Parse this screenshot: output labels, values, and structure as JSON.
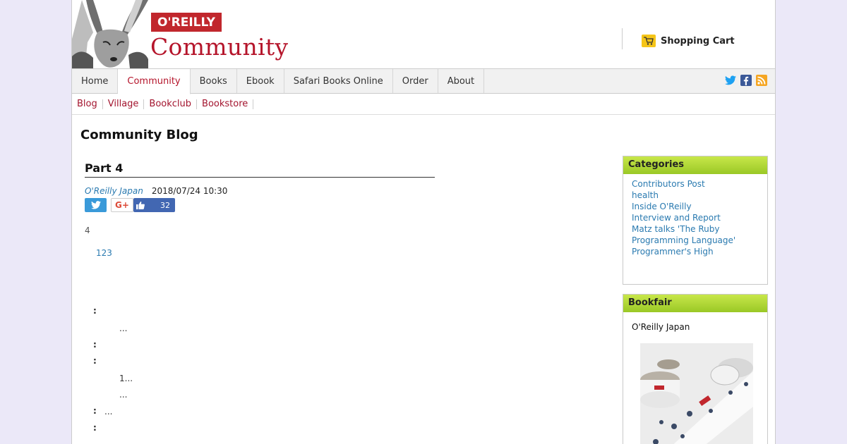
{
  "header": {
    "brand_badge": "O'REILLY",
    "brand_name": "Community",
    "cart_label": "Shopping Cart"
  },
  "nav": {
    "items": [
      {
        "label": "Home"
      },
      {
        "label": "Community"
      },
      {
        "label": "Books"
      },
      {
        "label": "Ebook"
      },
      {
        "label": "Safari Books Online"
      },
      {
        "label": "Order"
      },
      {
        "label": "About"
      }
    ],
    "active": "Community"
  },
  "subnav": {
    "items": [
      {
        "label": "Blog"
      },
      {
        "label": "Village"
      },
      {
        "label": "Bookclub"
      },
      {
        "label": "Bookstore"
      }
    ]
  },
  "page_title": "Community Blog",
  "article": {
    "title": "Part 4",
    "author": "O'Reilly Japan",
    "datetime": "2018/07/24 10:30",
    "like_count": "32",
    "gplus_label": "G+",
    "body_lead": "4",
    "link_number": "123",
    "colon": ":",
    "ellipsis": "...",
    "ellipsis_one": "1..."
  },
  "sidebar": {
    "categories_title": "Categories",
    "categories": [
      "Contributors Post",
      "health",
      "Inside O'Reilly",
      "Interview and Report",
      "Matz talks 'The Ruby",
      "Programming Language'",
      "Programmer's High"
    ],
    "bookfair_title": "Bookfair",
    "bookfair_text": "O'Reilly Japan"
  },
  "colors": {
    "brand_red": "#c1272d",
    "link_blue": "#2a7ab0",
    "sidebar_green": "#9ac826"
  },
  "icons": [
    "cart-icon",
    "twitter-icon",
    "facebook-icon",
    "rss-icon",
    "thumbs-up-icon",
    "google-plus-icon"
  ]
}
